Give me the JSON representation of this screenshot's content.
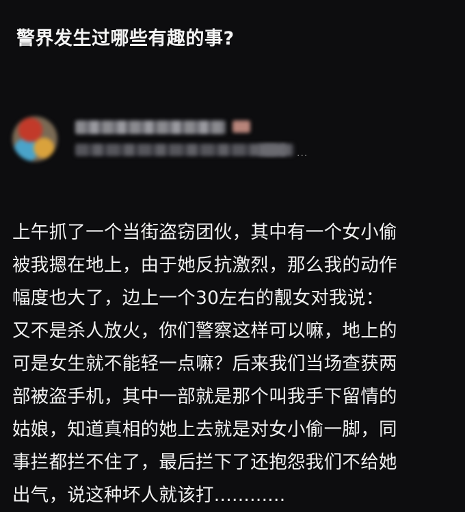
{
  "question": {
    "title": "警界发生过哪些有趣的事?"
  },
  "author": {
    "more_label": "..."
  },
  "answer": {
    "lines": [
      "上午抓了一个当街盗窃团伙，其中有一个女小偷",
      "被我摁在地上，由于她反抗激烈，那么我的动作",
      "幅度也大了，边上一个30左右的靓女对我说：",
      "又不是杀人放火，你们警察这样可以嘛，地上的",
      "可是女生就不能轻一点嘛？后来我们当场查获两",
      "部被盗手机，其中一部就是那个叫我手下留情的",
      "姑娘，知道真相的她上去就是对女小偷一脚，同",
      "事拦都拦不住了，最后拦下了还抱怨我们不给她",
      "出气，说这种坏人就该打............"
    ]
  }
}
